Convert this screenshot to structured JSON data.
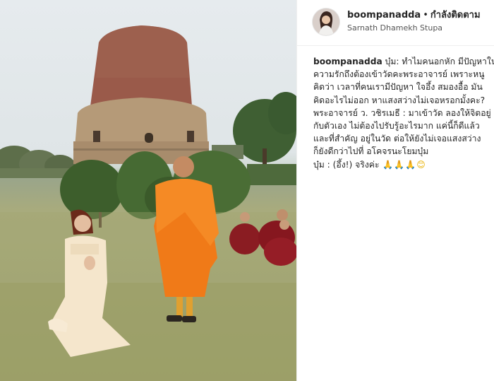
{
  "post": {
    "username": "boompanadda",
    "separator": "•",
    "follow_label": "กำลังติดตาม",
    "location": "Sarnath Dhamekh Stupa"
  },
  "caption": {
    "username": "boompanadda",
    "lines": [
      "บุ๋ม: ทำไมคนอกหัก มีปัญหาใน",
      "ความรักถึงต้องเข้าวัดคะพระอาจารย์ เพราะหนู",
      "คิดว่า เวลาที่คนเรามีปัญหา ใจอึ้ง สมองอื้อ มัน",
      "คิดอะไรไม่ออก หาแสงสว่างไม่เจอหรอกมั้งคะ?",
      "พระอาจารย์ ว. วชิรเมธี : มาเข้าวัด ลองให้จิตอยู่",
      "กับตัวเอง ไม่ต้องไปรับรู้อะไรมาก แค่นี้ก็ดีแล้ว",
      "และที่สำคัญ อยู่ในวัด ต่อให้ยังไม่เจอแสงสว่าง",
      "ก็ยังดีกว่าไปที่ อโคจรนะโยมบุ๋ม",
      "บุ๋ม : (อึ้ง!) จริงค่ะ"
    ],
    "emojis": [
      "🙏",
      "🙏",
      "🙏",
      "😊"
    ]
  },
  "colors": {
    "text": "#262626",
    "secondary_text": "#555555",
    "robe_orange": "#f07a18",
    "robe_maroon": "#8a1c22",
    "stupa_brick": "#9a5a4a"
  },
  "icons": {
    "avatar": "profile-photo",
    "emoji_pray": "folded-hands",
    "emoji_smile": "smiling-face"
  }
}
